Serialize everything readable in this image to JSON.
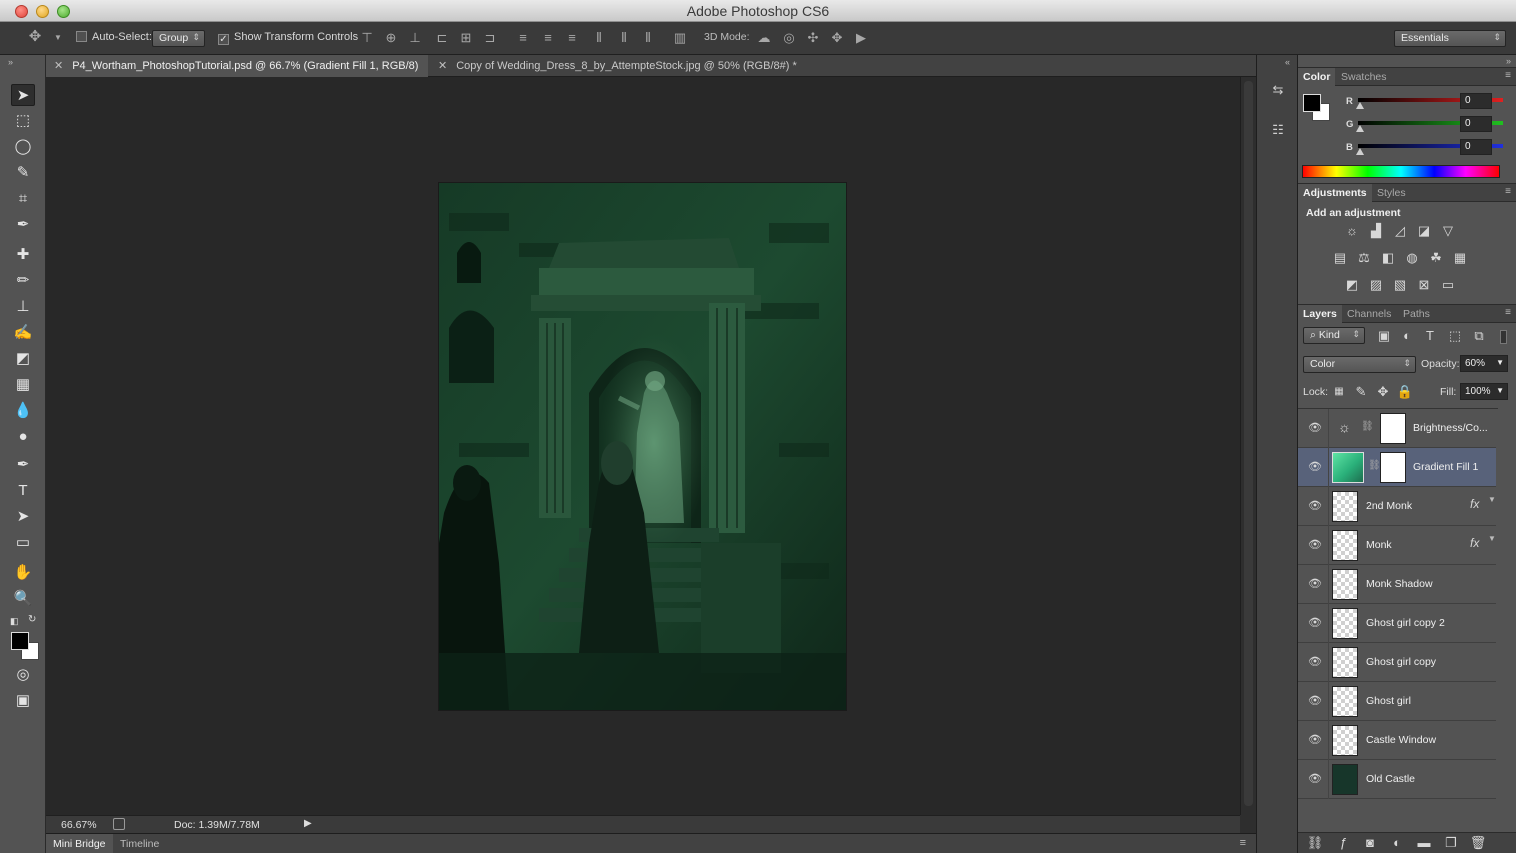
{
  "app": {
    "title": "Adobe Photoshop CS6"
  },
  "options_bar": {
    "auto_select_label": "Auto-Select:",
    "auto_select_value": "Group",
    "show_transform_label": "Show Transform Controls",
    "mode_3d_label": "3D Mode:",
    "workspace_value": "Essentials"
  },
  "documents": {
    "tabs": [
      {
        "label": "P4_Wortham_PhotoshopTutorial.psd @ 66.7% (Gradient Fill 1, RGB/8)",
        "active": true
      },
      {
        "label": "Copy of Wedding_Dress_8_by_AttempteStock.jpg @ 50% (RGB/8#) *",
        "active": false
      }
    ]
  },
  "status": {
    "zoom": "66.67%",
    "doc_size": "Doc: 1.39M/7.78M"
  },
  "bottom_tabs": [
    "Mini Bridge",
    "Timeline"
  ],
  "color_panel": {
    "tabs": [
      "Color",
      "Swatches"
    ],
    "channels": [
      {
        "label": "R",
        "value": "0",
        "color": "#e02020"
      },
      {
        "label": "G",
        "value": "0",
        "color": "#20c020"
      },
      {
        "label": "B",
        "value": "0",
        "color": "#2030e0"
      }
    ]
  },
  "adjustments_panel": {
    "tabs": [
      "Adjustments",
      "Styles"
    ],
    "heading": "Add an adjustment"
  },
  "layers_panel": {
    "tabs": [
      "Layers",
      "Channels",
      "Paths"
    ],
    "filter_value": "Kind",
    "blend_mode": "Color",
    "opacity_label": "Opacity:",
    "opacity_value": "60%",
    "lock_label": "Lock:",
    "fill_label": "Fill:",
    "fill_value": "100%",
    "layers": [
      {
        "name": "Brightness/Co...",
        "fx": ""
      },
      {
        "name": "Gradient Fill 1",
        "fx": ""
      },
      {
        "name": "2nd Monk",
        "fx": "fx"
      },
      {
        "name": "Monk",
        "fx": "fx"
      },
      {
        "name": "Monk Shadow",
        "fx": ""
      },
      {
        "name": "Ghost girl copy 2",
        "fx": ""
      },
      {
        "name": "Ghost girl copy",
        "fx": ""
      },
      {
        "name": "Ghost girl",
        "fx": ""
      },
      {
        "name": "Castle Window",
        "fx": ""
      },
      {
        "name": "Old Castle",
        "fx": ""
      }
    ]
  }
}
